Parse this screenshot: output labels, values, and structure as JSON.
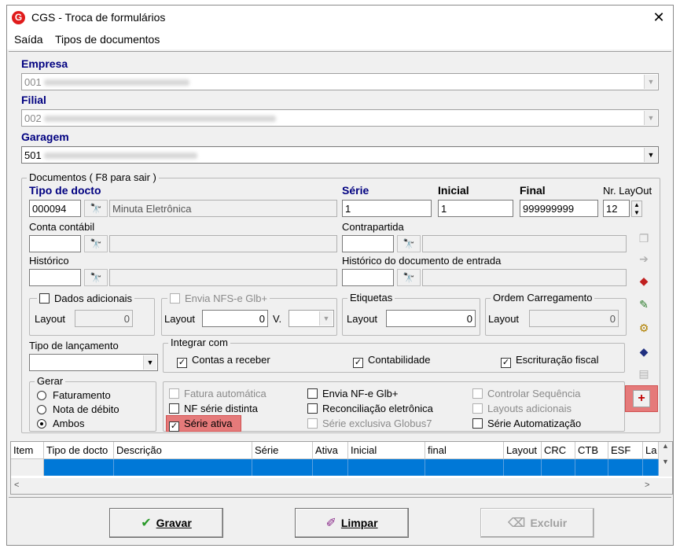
{
  "window": {
    "title": "CGS - Troca de formulários",
    "close": "✕",
    "logo": "G"
  },
  "menu": {
    "saida": "Saída",
    "tipos": "Tipos de documentos"
  },
  "empresa": {
    "label": "Empresa",
    "value": "001"
  },
  "filial": {
    "label": "Filial",
    "value": "002"
  },
  "garagem": {
    "label": "Garagem",
    "value": "501"
  },
  "documentos": {
    "group_label": "Documentos ( F8 para sair )",
    "tipo_docto_label": "Tipo de docto",
    "tipo_docto_code": "000094",
    "tipo_docto_desc": "Minuta Eletrônica",
    "serie_label": "Série",
    "serie_value": "1",
    "inicial_label": "Inicial",
    "inicial_value": "1",
    "final_label": "Final",
    "final_value": "999999999",
    "nr_layout_label": "Nr. LayOut",
    "nr_layout_value": "12",
    "conta_contabil_label": "Conta contábil",
    "contrapartida_label": "Contrapartida",
    "historico_label": "Histórico",
    "historico_entrada_label": "Histórico do documento de entrada",
    "dados_adicionais": {
      "label": "Dados adicionais",
      "layout_label": "Layout",
      "layout_value": "0"
    },
    "envia_nfse": {
      "label": "Envia NFS-e Glb+",
      "layout_label": "Layout",
      "layout_value": "0",
      "v_label": "V."
    },
    "etiquetas": {
      "label": "Etiquetas",
      "layout_label": "Layout",
      "layout_value": "0"
    },
    "ordem": {
      "label": "Ordem Carregamento",
      "layout_label": "Layout",
      "layout_value": "0"
    },
    "tipo_lancamento_label": "Tipo de lançamento",
    "integrar": {
      "label": "Integrar com",
      "contas_receber": "Contas a receber",
      "contabilidade": "Contabilidade",
      "escrituracao": "Escrituração fiscal"
    },
    "gerar": {
      "label": "Gerar",
      "faturamento": "Faturamento",
      "nota_debito": "Nota de débito",
      "ambos": "Ambos"
    },
    "options": {
      "fatura_automatica": "Fatura automática",
      "nf_serie_distinta": "NF série distinta",
      "serie_ativa": "Série ativa",
      "envia_nfe": "Envia NF-e Glb+",
      "reconciliacao": "Reconciliação eletrônica",
      "serie_exclusiva": "Série exclusiva Globus7",
      "controlar_sequencia": "Controlar Sequência",
      "layouts_adicionais": "Layouts adicionais",
      "serie_automatizacao": "Série Automatização"
    },
    "add_button": "+"
  },
  "grid": {
    "columns": [
      "Item",
      "Tipo de docto",
      "Descrição",
      "Série",
      "Ativa",
      "Inicial",
      "final",
      "Layout",
      "CRC",
      "CTB",
      "ESF",
      "La"
    ]
  },
  "buttons": {
    "gravar": "Gravar",
    "limpar": "Limpar",
    "excluir": "Excluir"
  },
  "colors": {
    "label_blue": "#000080",
    "selection": "#0078d7",
    "highlight": "#e57a7a"
  }
}
